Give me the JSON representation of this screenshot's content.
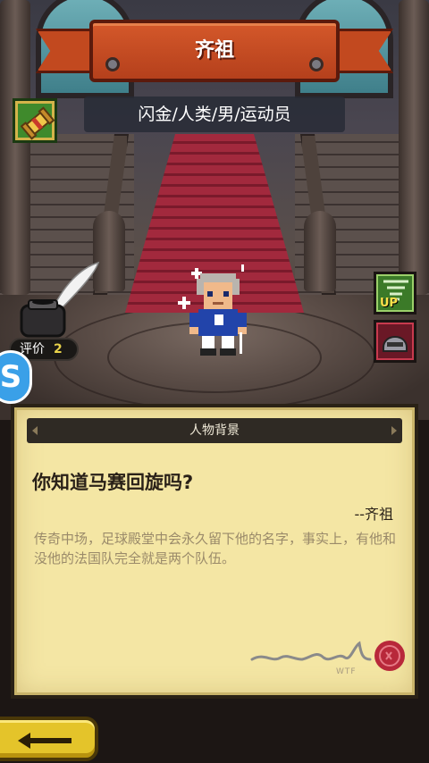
{
  "header": {
    "title": "齐祖",
    "subtitle": "闪金/人类/男/运动员"
  },
  "rating": {
    "label": "评价",
    "value": "2"
  },
  "side_buttons": {
    "upgrade_label": "UP"
  },
  "assistant": {
    "glyph": "S"
  },
  "panel": {
    "header": "人物背景",
    "quote": "你知道马赛回旋吗?",
    "author": "--齐祖",
    "bio": "传奇中场，足球殿堂中会永久留下他的名字，事实上，有他和没他的法国队完全就是两个队伍。",
    "signature_sub": "WTF"
  },
  "colors": {
    "banner": "#c2491f",
    "parchment": "#f4e6a4",
    "back_button": "#e4c42a",
    "upgrade_button": "#3b7a28",
    "gear_button": "#6a1826"
  },
  "icons": [
    "scroll-icon",
    "inkpot-quill-icon",
    "tornado-up-icon",
    "helmet-icon",
    "wax-seal-icon",
    "back-arrow-icon"
  ]
}
